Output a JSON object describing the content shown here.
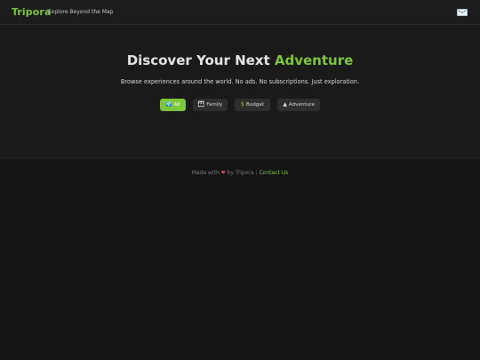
{
  "header": {
    "brand": "Tripora",
    "tagline": "Explore Beyond the Map",
    "mail_icon": "mail-icon"
  },
  "hero": {
    "title_part1": "Discover Your Next ",
    "title_accent": "Adventure",
    "subtitle": "Browse experiences around the world. No ads. No subscriptions. Just exploration.",
    "filters": [
      {
        "label": "All",
        "icon": "globe-icon",
        "glyph": "🌍",
        "active": true
      },
      {
        "label": "Family",
        "icon": "family-icon",
        "glyph": "👪",
        "active": false
      },
      {
        "label": "Budget",
        "icon": "dollar-icon",
        "glyph": "$",
        "active": false
      },
      {
        "label": "Adventure",
        "icon": "mountain-icon",
        "glyph": "▲",
        "active": false
      }
    ]
  },
  "footer": {
    "made_with": "Made with",
    "by": "by Tripora",
    "separator": "|",
    "contact": "Contact Us"
  },
  "colors": {
    "accent": "#7ec63c",
    "background": "#151515",
    "hero_background": "#1a1a1a",
    "heart": "#e05050"
  }
}
